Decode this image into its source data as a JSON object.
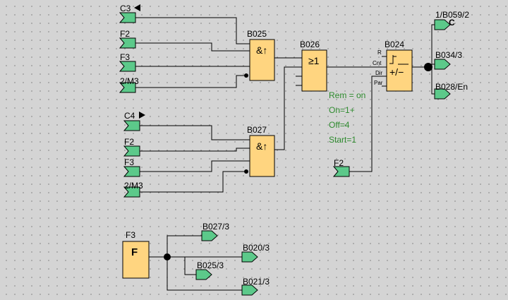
{
  "colors": {
    "canvas": "#d4d4d4",
    "block_fill": "#ffd580",
    "connector_fill": "#5cc98a",
    "parameter_text": "#2e8b2e",
    "wire": "#000000"
  },
  "inputs": [
    {
      "id": "in-c3",
      "label": "C3",
      "marker": "triangle-left"
    },
    {
      "id": "in-f2a",
      "label": "F2",
      "marker": ""
    },
    {
      "id": "in-f3a",
      "label": "F3",
      "marker": ""
    },
    {
      "id": "in-m3a",
      "label": "2/M3",
      "marker": ""
    },
    {
      "id": "in-c4",
      "label": "C4",
      "marker": "triangle-right"
    },
    {
      "id": "in-f2b",
      "label": "F2",
      "marker": ""
    },
    {
      "id": "in-f3b",
      "label": "F3",
      "marker": ""
    },
    {
      "id": "in-m3b",
      "label": "2/M3",
      "marker": ""
    },
    {
      "id": "in-f2c",
      "label": "F2",
      "marker": ""
    }
  ],
  "blocks": [
    {
      "id": "b025",
      "name": "B025",
      "symbol": "&↑",
      "type": "AND (edge)"
    },
    {
      "id": "b027",
      "name": "B027",
      "symbol": "&↑",
      "type": "AND (edge)"
    },
    {
      "id": "b026",
      "name": "B026",
      "symbol": "≥1",
      "type": "OR"
    },
    {
      "id": "b024",
      "name": "B024",
      "symbol": "+/−",
      "type": "Up/Down counter",
      "pins": [
        "R",
        "Cnt",
        "Dir",
        "Par"
      ]
    },
    {
      "id": "f3",
      "name": "F3",
      "symbol": "F",
      "type": "Flag"
    }
  ],
  "counter_params": [
    "Rem = on",
    "On=1+",
    "Off=4",
    "Start=1"
  ],
  "outputs": [
    {
      "id": "out-b059",
      "label": "1/B059/2",
      "marker": "C"
    },
    {
      "id": "out-b034",
      "label": "B034/3",
      "marker": ""
    },
    {
      "id": "out-b028",
      "label": "B028/En",
      "marker": ""
    },
    {
      "id": "out-b027",
      "label": "B027/3",
      "marker": ""
    },
    {
      "id": "out-b020",
      "label": "B020/3",
      "marker": ""
    },
    {
      "id": "out-b025",
      "label": "B025/3",
      "marker": ""
    },
    {
      "id": "out-b021",
      "label": "B021/3",
      "marker": ""
    }
  ]
}
